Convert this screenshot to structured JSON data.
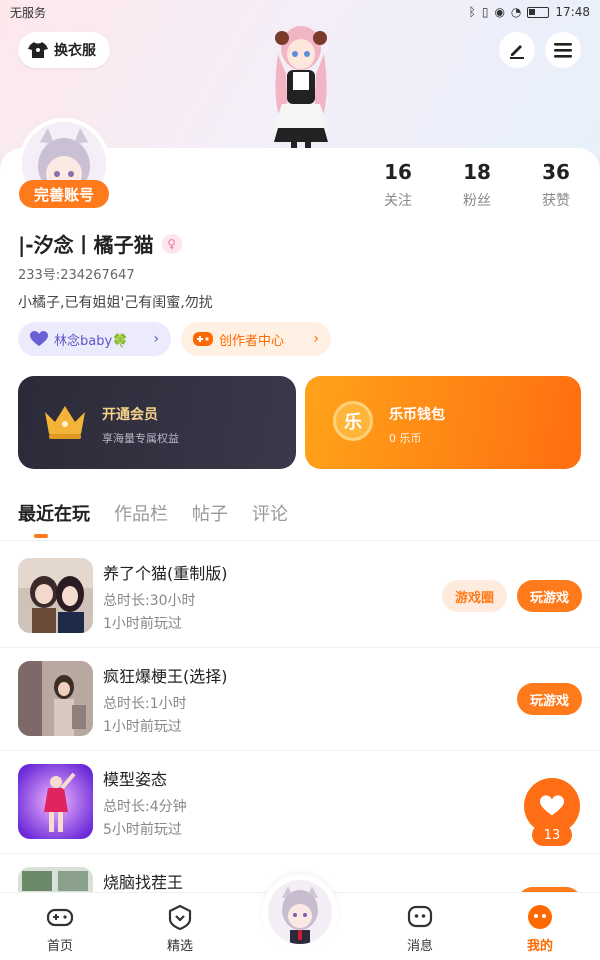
{
  "status_bar": {
    "carrier": "无服务",
    "time": "17:48"
  },
  "header": {
    "outfit_label": "换衣服"
  },
  "profile": {
    "complete_badge": "完善账号",
    "stats": [
      {
        "value": "16",
        "label": "关注"
      },
      {
        "value": "18",
        "label": "粉丝"
      },
      {
        "value": "36",
        "label": "获赞"
      }
    ],
    "username": "|-汐念丨橘子猫",
    "id_text": "233号:234267647",
    "bio": "小橘子,已有姐姐'己有闺蜜,勿扰",
    "tags": [
      {
        "label": "林念baby🍀",
        "icon": "heart-icon"
      },
      {
        "label": "创作者中心",
        "icon": "gamepad-icon"
      }
    ]
  },
  "cards": {
    "vip": {
      "title": "开通会员",
      "subtitle": "享海量专属权益"
    },
    "wallet": {
      "title": "乐币钱包",
      "subtitle": "0 乐币",
      "coin_glyph": "乐"
    }
  },
  "tabs": [
    "最近在玩",
    "作品栏",
    "帖子",
    "评论"
  ],
  "games": [
    {
      "title": "养了个猫(重制版)",
      "duration": "总时长:30小时",
      "last_played": "1小时前玩过",
      "circle_label": "游戏圈",
      "play_label": "玩游戏"
    },
    {
      "title": "疯狂爆梗王(选择)",
      "duration": "总时长:1小时",
      "last_played": "1小时前玩过",
      "play_label": "玩游戏"
    },
    {
      "title": "模型姿态",
      "duration": "总时长:4分钟",
      "last_played": "5小时前玩过"
    },
    {
      "title": "烧脑找茬王"
    }
  ],
  "fab": {
    "count": "13"
  },
  "bottom_nav": [
    {
      "label": "首页",
      "icon": "gamepad-icon"
    },
    {
      "label": "精选",
      "icon": "heart-shield-icon"
    },
    {
      "label": "消息",
      "icon": "chat-face-icon"
    },
    {
      "label": "我的",
      "icon": "profile-face-icon"
    }
  ],
  "colors": {
    "accent": "#ff7a1a",
    "vip_dark": "#2b2a38",
    "wallet_orange": "#ff8a14"
  }
}
